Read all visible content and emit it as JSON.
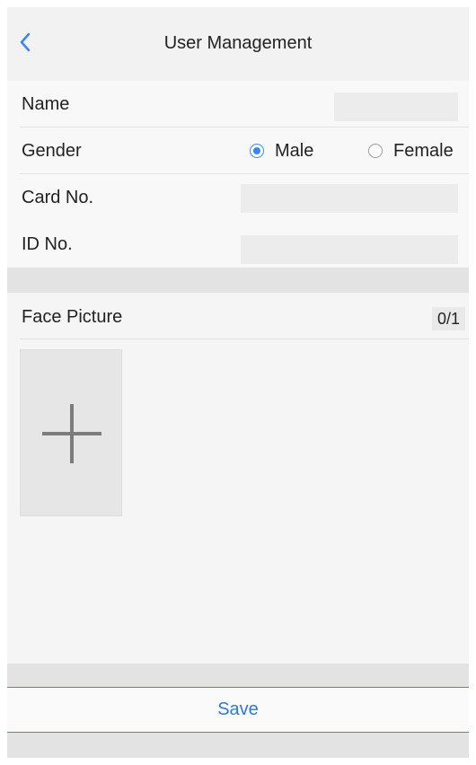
{
  "header": {
    "title": "User Management",
    "back_icon": "chevron-left-icon"
  },
  "form": {
    "name": {
      "label": "Name",
      "value": ""
    },
    "gender": {
      "label": "Gender",
      "options": [
        {
          "label": "Male",
          "checked": true
        },
        {
          "label": "Female",
          "checked": false
        }
      ]
    },
    "card_no": {
      "label": "Card No.",
      "value": ""
    },
    "id_no": {
      "label": "ID No.",
      "value": ""
    }
  },
  "face": {
    "label": "Face Picture",
    "count": "0/1",
    "add_icon": "plus-icon"
  },
  "actions": {
    "save_label": "Save"
  },
  "colors": {
    "accent": "#3a86f0",
    "save_text": "#2f78d8"
  }
}
